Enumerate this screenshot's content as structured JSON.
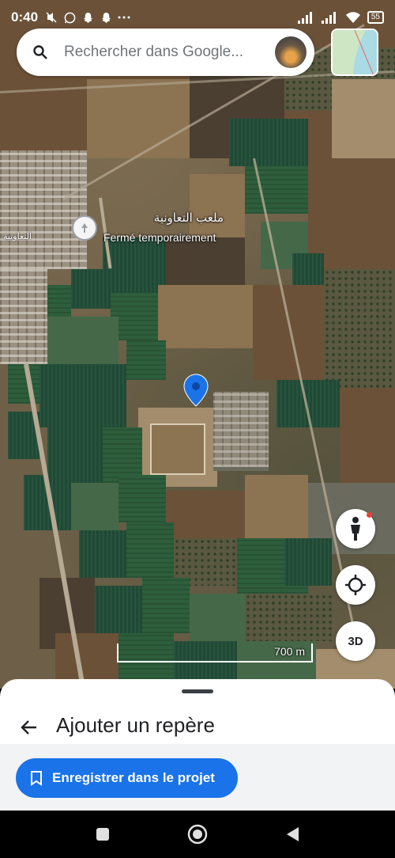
{
  "status_bar": {
    "time": "0:40",
    "battery": "55",
    "icons": [
      "mute-icon",
      "whatsapp-icon",
      "snapchat-icon",
      "snapchat-icon",
      "more-notifications-icon",
      "signal-icon",
      "signal-icon",
      "wifi-icon",
      "battery-icon"
    ]
  },
  "search": {
    "placeholder": "Rechercher dans Google..."
  },
  "map": {
    "poi": {
      "name": "ملعب التعاونية",
      "status": "Fermé temporairement",
      "icon": "poi-pin-icon"
    },
    "place_label_left": "التعاونية",
    "scale_label": "700 m",
    "buttons": {
      "view_3d": "3D"
    }
  },
  "bottom_sheet": {
    "title": "Ajouter un repère",
    "save_button": "Enregistrer dans le projet"
  },
  "colors": {
    "accent": "#1a73e8",
    "pin": "#1a73e8"
  }
}
